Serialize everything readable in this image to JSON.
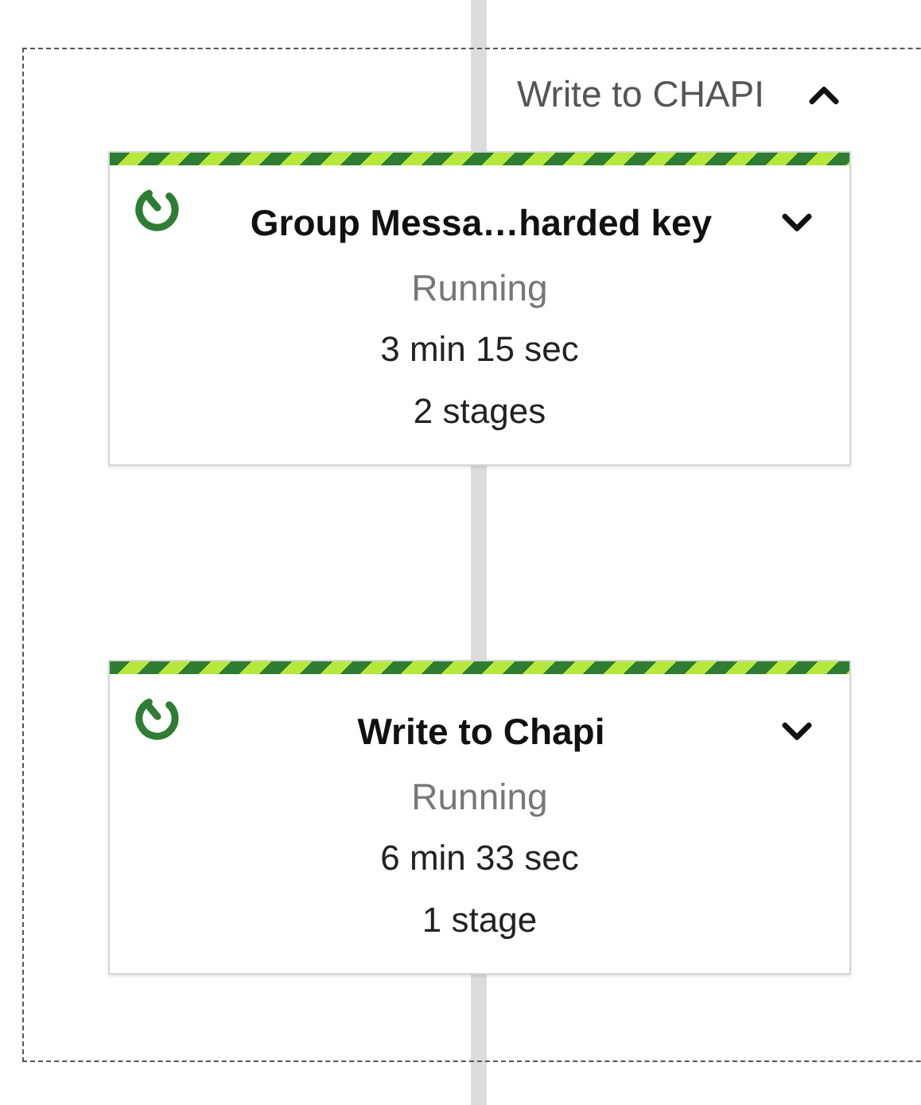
{
  "group": {
    "title": "Write to CHAPI",
    "expanded": true
  },
  "steps": [
    {
      "title": "Group Messa…harded key",
      "kind": "running",
      "status_text": "Running",
      "duration": "3 min 15 sec",
      "stages": "2 stages",
      "expanded": false
    },
    {
      "title": "Write to Chapi",
      "kind": "running",
      "status_text": "Running",
      "duration": "6 min 33 sec",
      "stages": "1 stage",
      "expanded": false
    }
  ]
}
